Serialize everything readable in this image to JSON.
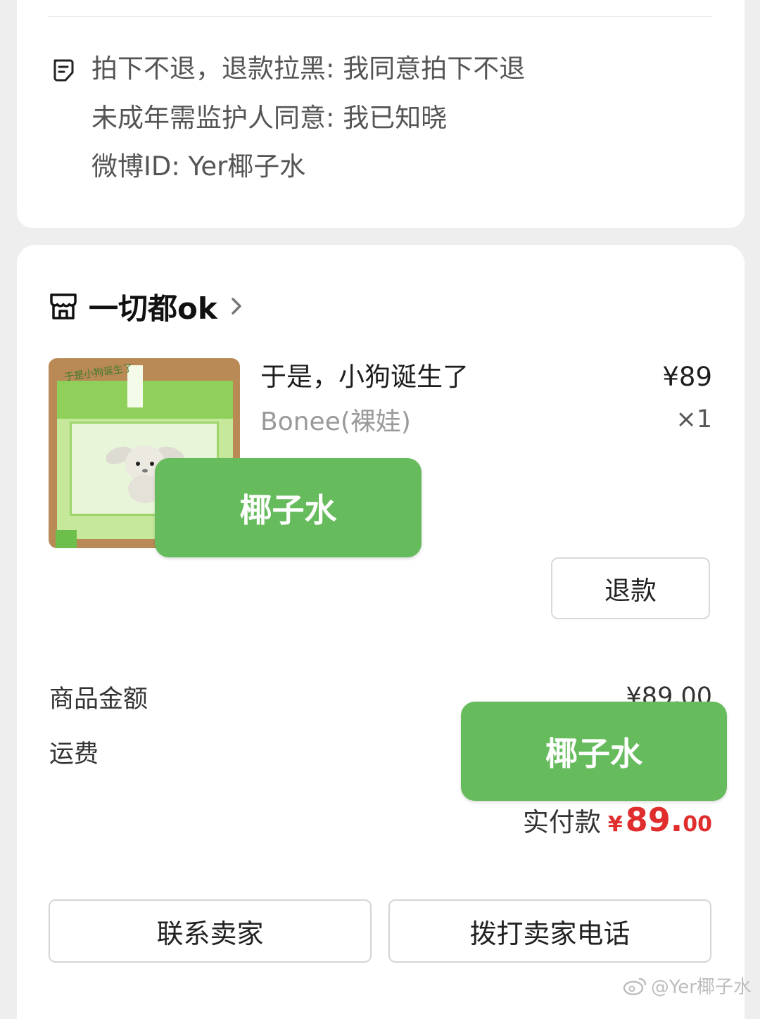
{
  "notes": {
    "line1": "拍下不退，退款拉黑: 我同意拍下不退",
    "line2": "未成年需监护人同意: 我已知晓",
    "line3": "微博ID: Yer椰子水"
  },
  "shop": {
    "name": "一切都ok"
  },
  "product": {
    "title": "于是，小狗诞生了",
    "subtitle": "Bonee(裸娃)",
    "price": "¥89",
    "quantity": "×1",
    "image_text": "于是小狗诞生了"
  },
  "refund_button": "退款",
  "summary": {
    "goods_label": "商品金额",
    "goods_value": "¥89.00",
    "shipping_label": "运费"
  },
  "paid": {
    "label": "实付款",
    "yen": "¥",
    "integer": "89.",
    "decimal": "00"
  },
  "stickers": [
    "椰子水",
    "椰子水"
  ],
  "actions": {
    "contact_seller": "联系卖家",
    "call_seller": "拨打卖家电话"
  },
  "watermark": "@Yer椰子水",
  "colors": {
    "sticker": "#66bb5c",
    "price_red": "#e02d2d"
  }
}
